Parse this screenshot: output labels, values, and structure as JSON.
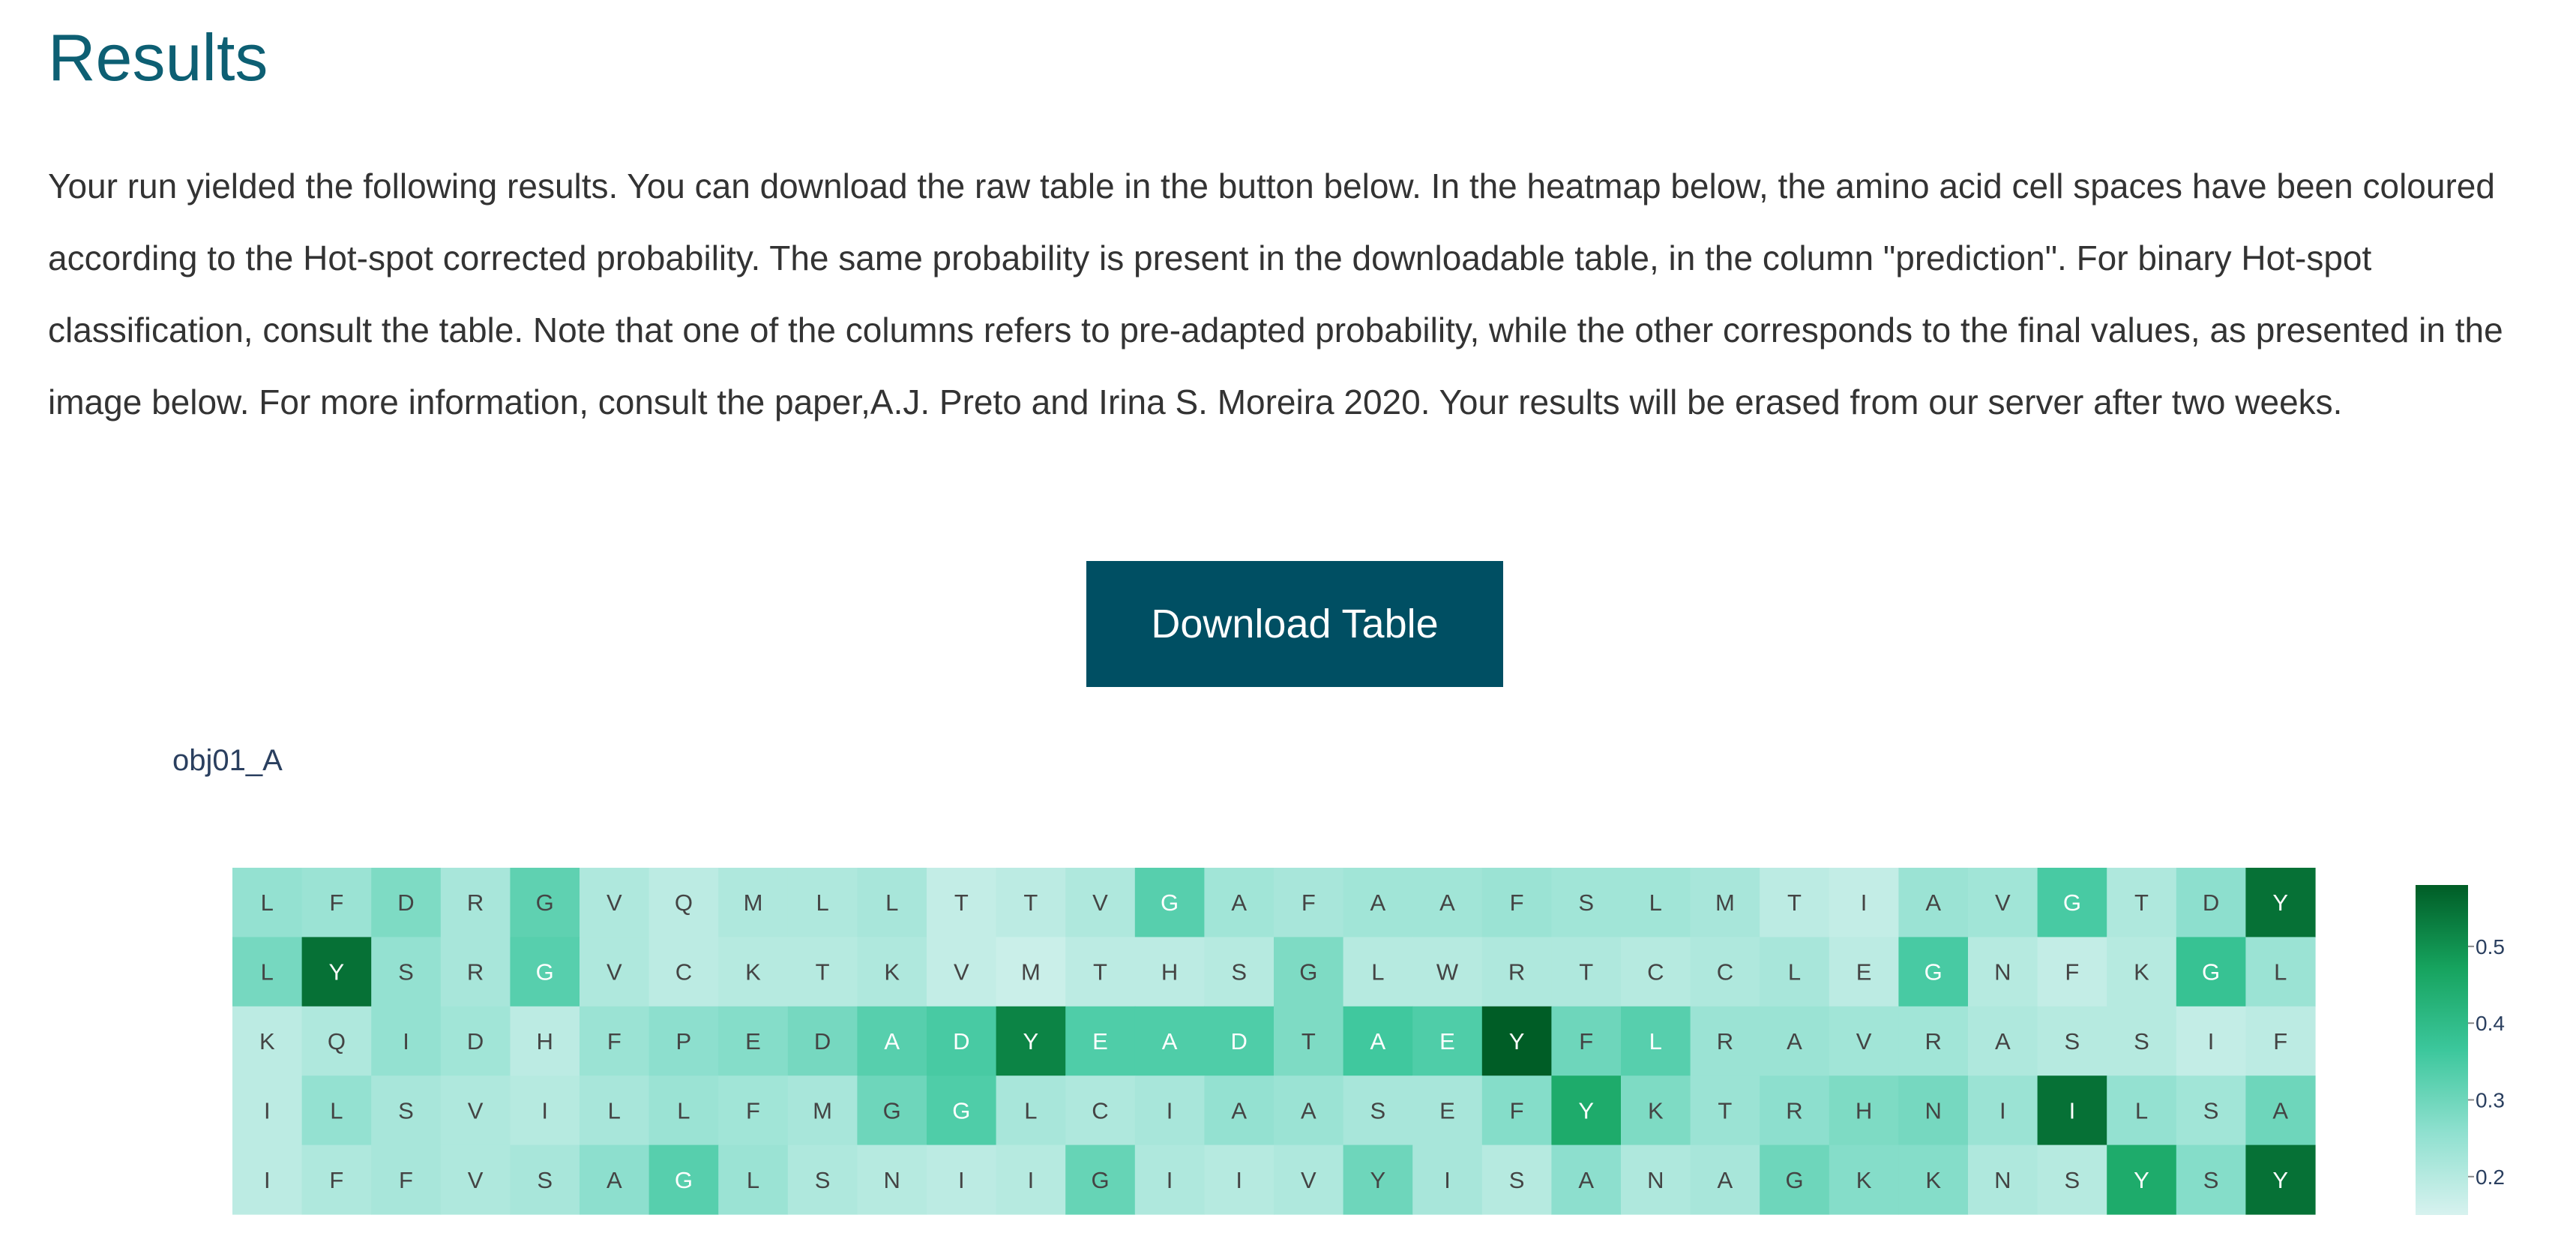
{
  "page": {
    "title": "Results",
    "intro": "Your run yielded the following results. You can download the raw table in the button below. In the heatmap below, the amino acid cell spaces have been coloured according to the Hot-spot corrected probability. The same probability is present in the downloadable table, in the column \"prediction\". For binary Hot-spot classification, consult the table. Note that one of the columns refers to pre-adapted probability, while the other corresponds to the final values, as presented in the image below. For more information, consult the paper,A.J. Preto and Irina S. Moreira 2020. Your results will be erased from our server after two weeks.",
    "download_label": "Download Table"
  },
  "chart_data": {
    "type": "heatmap",
    "title": "obj01_A",
    "xlabel": "",
    "ylabel": "",
    "colorscale": [
      "#d7f2ef",
      "#8fe0cf",
      "#3cc79c",
      "#16a35e",
      "#005d26"
    ],
    "zmin": 0.15,
    "zmax": 0.58,
    "colorbar_ticks": [
      0.2,
      0.3,
      0.4,
      0.5
    ],
    "rows": [
      {
        "letters": [
          "L",
          "F",
          "D",
          "R",
          "G",
          "V",
          "Q",
          "M",
          "L",
          "L",
          "T",
          "T",
          "V",
          "G",
          "A",
          "F",
          "A",
          "A",
          "F",
          "S",
          "L",
          "M",
          "T",
          "I",
          "A",
          "V",
          "G",
          "T",
          "D",
          "Y"
        ],
        "values": [
          0.25,
          0.24,
          0.28,
          0.22,
          0.32,
          0.21,
          0.19,
          0.21,
          0.21,
          0.22,
          0.18,
          0.19,
          0.21,
          0.33,
          0.23,
          0.22,
          0.23,
          0.23,
          0.24,
          0.23,
          0.23,
          0.22,
          0.19,
          0.18,
          0.24,
          0.23,
          0.35,
          0.21,
          0.26,
          0.55
        ]
      },
      {
        "letters": [
          "L",
          "Y",
          "S",
          "R",
          "G",
          "V",
          "C",
          "K",
          "T",
          "K",
          "V",
          "M",
          "T",
          "H",
          "S",
          "G",
          "L",
          "W",
          "R",
          "T",
          "C",
          "C",
          "L",
          "E",
          "G",
          "N",
          "F",
          "K",
          "G",
          "L"
        ],
        "values": [
          0.29,
          0.55,
          0.25,
          0.22,
          0.33,
          0.21,
          0.19,
          0.2,
          0.2,
          0.21,
          0.18,
          0.17,
          0.19,
          0.19,
          0.2,
          0.28,
          0.2,
          0.2,
          0.21,
          0.21,
          0.2,
          0.21,
          0.22,
          0.19,
          0.35,
          0.2,
          0.18,
          0.2,
          0.38,
          0.24
        ]
      },
      {
        "letters": [
          "K",
          "Q",
          "I",
          "D",
          "H",
          "F",
          "P",
          "E",
          "D",
          "A",
          "D",
          "Y",
          "E",
          "A",
          "D",
          "T",
          "A",
          "E",
          "Y",
          "F",
          "L",
          "R",
          "A",
          "V",
          "R",
          "A",
          "S",
          "S",
          "I",
          "F"
        ],
        "values": [
          0.19,
          0.21,
          0.25,
          0.23,
          0.19,
          0.24,
          0.26,
          0.27,
          0.29,
          0.33,
          0.35,
          0.52,
          0.34,
          0.34,
          0.34,
          0.28,
          0.36,
          0.34,
          0.58,
          0.3,
          0.33,
          0.24,
          0.24,
          0.23,
          0.23,
          0.21,
          0.2,
          0.2,
          0.18,
          0.19
        ]
      },
      {
        "letters": [
          "I",
          "L",
          "S",
          "V",
          "I",
          "L",
          "L",
          "F",
          "M",
          "G",
          "G",
          "L",
          "C",
          "I",
          "A",
          "A",
          "S",
          "E",
          "F",
          "Y",
          "K",
          "T",
          "R",
          "H",
          "N",
          "I",
          "I",
          "L",
          "S",
          "A"
        ],
        "values": [
          0.19,
          0.25,
          0.22,
          0.21,
          0.2,
          0.22,
          0.24,
          0.23,
          0.22,
          0.3,
          0.34,
          0.22,
          0.21,
          0.22,
          0.25,
          0.24,
          0.22,
          0.22,
          0.27,
          0.45,
          0.28,
          0.24,
          0.26,
          0.28,
          0.29,
          0.24,
          0.55,
          0.25,
          0.23,
          0.3
        ]
      },
      {
        "letters": [
          "I",
          "F",
          "F",
          "V",
          "S",
          "A",
          "G",
          "L",
          "S",
          "N",
          "I",
          "I",
          "G",
          "I",
          "I",
          "V",
          "Y",
          "I",
          "S",
          "A",
          "N",
          "A",
          "G",
          "K",
          "K",
          "N",
          "S",
          "Y",
          "S",
          "Y"
        ],
        "values": [
          0.19,
          0.21,
          0.22,
          0.21,
          0.22,
          0.26,
          0.33,
          0.24,
          0.21,
          0.2,
          0.19,
          0.2,
          0.31,
          0.21,
          0.2,
          0.21,
          0.3,
          0.22,
          0.2,
          0.26,
          0.21,
          0.22,
          0.3,
          0.27,
          0.27,
          0.21,
          0.2,
          0.45,
          0.27,
          0.55
        ]
      }
    ]
  }
}
